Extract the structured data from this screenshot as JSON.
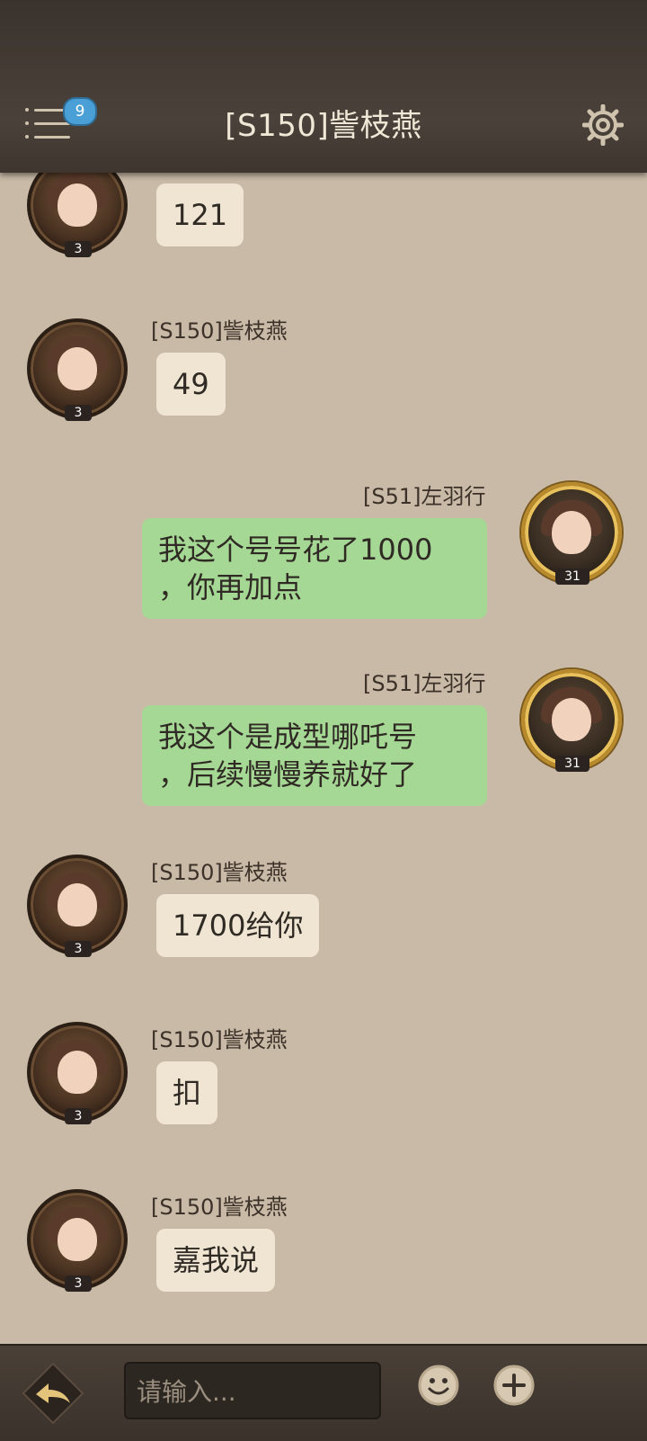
{
  "header": {
    "title": "[S150]訾枝燕",
    "badge_count": "9",
    "menu_icon": "menu-icon",
    "settings_icon": "gear-icon"
  },
  "messages": [
    {
      "side": "left",
      "name": "",
      "text": "121",
      "avatar_level": "3"
    },
    {
      "side": "left",
      "name": "[S150]訾枝燕",
      "text": "49",
      "avatar_level": "3"
    },
    {
      "side": "right",
      "name": "[S51]左羽行",
      "text": "我这个号号花了1000\n，你再加点",
      "avatar_level": "31"
    },
    {
      "side": "right",
      "name": "[S51]左羽行",
      "text": "我这个是成型哪吒号\n，后续慢慢养就好了",
      "avatar_level": "31"
    },
    {
      "side": "left",
      "name": "[S150]訾枝燕",
      "text": "1700给你",
      "avatar_level": "3"
    },
    {
      "side": "left",
      "name": "[S150]訾枝燕",
      "text": "扣",
      "avatar_level": "3"
    },
    {
      "side": "left",
      "name": "[S150]訾枝燕",
      "text": "嘉我说",
      "avatar_level": "3"
    }
  ],
  "footer": {
    "input_placeholder": "请输入...",
    "back_icon": "back-arrow-icon",
    "emoji_icon": "smiley-icon",
    "plus_icon": "plus-icon"
  },
  "colors": {
    "bubble_left": "#efe5d2",
    "bubble_right": "#a6d895",
    "background": "#c8baa6",
    "badge": "#4aa0d6"
  }
}
